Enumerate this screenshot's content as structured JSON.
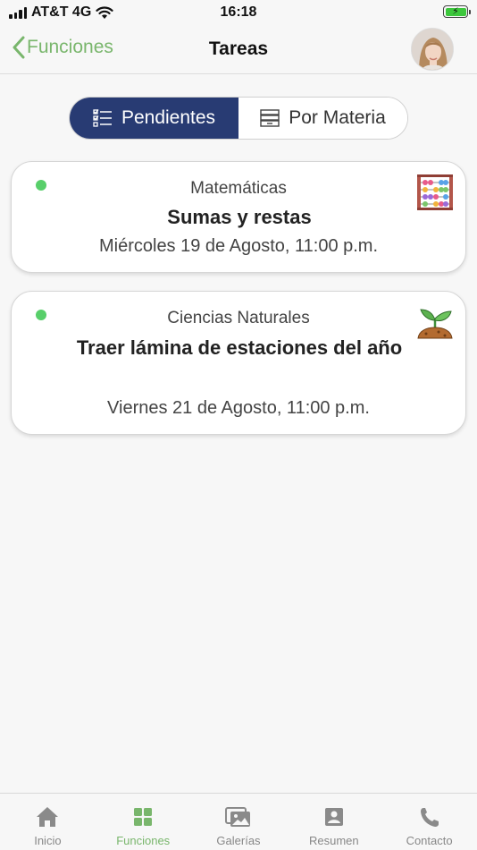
{
  "status_bar": {
    "carrier": "AT&T 4G",
    "time": "16:18"
  },
  "nav": {
    "back_label": "Funciones",
    "title": "Tareas"
  },
  "segmented": {
    "options": [
      {
        "label": "Pendientes",
        "icon": "checklist-icon",
        "selected": true
      },
      {
        "label": "Por Materia",
        "icon": "archive-box-icon",
        "selected": false
      }
    ]
  },
  "tasks": [
    {
      "subject": "Matemáticas",
      "title": "Sumas y restas",
      "date": "Miércoles 19 de Agosto, 11:00 p.m.",
      "icon": "abacus-icon",
      "status_color": "#58cf6a"
    },
    {
      "subject": "Ciencias Naturales",
      "title": "Traer lámina de estaciones del año",
      "date": "Viernes 21 de Agosto, 11:00 p.m.",
      "icon": "sprout-icon",
      "status_color": "#58cf6a"
    }
  ],
  "tab_bar": {
    "tabs": [
      {
        "label": "Inicio",
        "icon": "home-icon"
      },
      {
        "label": "Funciones",
        "icon": "grid-icon",
        "selected": true
      },
      {
        "label": "Galerías",
        "icon": "gallery-icon"
      },
      {
        "label": "Resumen",
        "icon": "profile-card-icon"
      },
      {
        "label": "Contacto",
        "icon": "phone-icon"
      }
    ]
  },
  "colors": {
    "accent_green": "#79b66c",
    "segment_active": "#283b73",
    "status_dot": "#58cf6a"
  }
}
